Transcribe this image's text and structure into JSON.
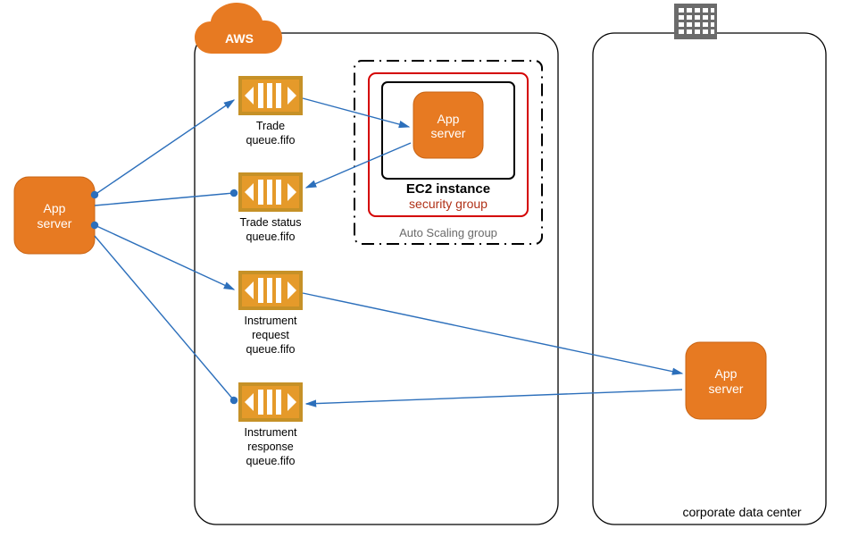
{
  "brand": {
    "aws": "AWS"
  },
  "left_server": {
    "label1": "App",
    "label2": "server"
  },
  "queues": {
    "trade": {
      "line1": "Trade",
      "line2": "queue.fifo"
    },
    "trade_status": {
      "line1": "Trade status",
      "line2": "queue.fifo"
    },
    "instr_req": {
      "line1": "Instrument",
      "line2": "request",
      "line3": "queue.fifo"
    },
    "instr_resp": {
      "line1": "Instrument",
      "line2": "response",
      "line3": "queue.fifo"
    }
  },
  "asg": {
    "title": "Auto Scaling group",
    "ec2": "EC2 instance",
    "secgrp": "security group",
    "app1": "App",
    "app2": "server"
  },
  "datacenter": {
    "label": "corporate data center",
    "app1": "App",
    "app2": "server"
  }
}
